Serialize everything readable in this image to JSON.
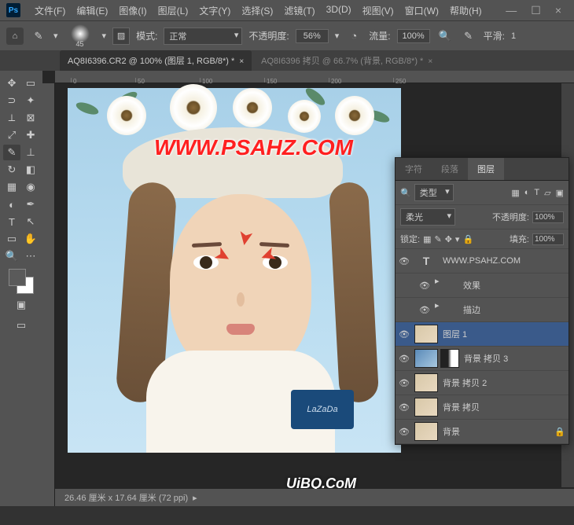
{
  "menu": {
    "items": [
      "文件(F)",
      "编辑(E)",
      "图像(I)",
      "图层(L)",
      "文字(Y)",
      "选择(S)",
      "滤镜(T)",
      "3D(D)",
      "视图(V)",
      "窗口(W)",
      "帮助(H)"
    ]
  },
  "wincontrols": {
    "min": "—",
    "max": "☐",
    "close": "×"
  },
  "optbar": {
    "brush_size": "45",
    "mode_label": "模式:",
    "mode_value": "正常",
    "opacity_label": "不透明度:",
    "opacity_value": "56%",
    "flow_label": "流量:",
    "flow_value": "100%",
    "smooth_label": "平滑:",
    "smooth_value": "1"
  },
  "tabs": [
    {
      "label": "AQ8I6396.CR2 @ 100% (图层 1, RGB/8*) *",
      "active": true
    },
    {
      "label": "AQ8I6396 拷贝 @ 66.7% (背景, RGB/8*) *",
      "active": false
    }
  ],
  "ruler_ticks": [
    "0",
    "50",
    "100",
    "150",
    "200",
    "250"
  ],
  "watermark": "WWW.PSAHZ.COM",
  "uibq": "UiBQ.CoM",
  "bluebox": "LaZaDa",
  "statusbar": "26.46 厘米 x 17.64 厘米 (72 ppi)",
  "panel": {
    "tabs": [
      "字符",
      "段落",
      "图层"
    ],
    "active_tab": 2,
    "filter_label": "类型",
    "blend_mode": "柔光",
    "opacity_label": "不透明度:",
    "opacity_value": "100%",
    "lock_label": "锁定:",
    "fill_label": "填充:",
    "fill_value": "100%",
    "layers": [
      {
        "vis": true,
        "type": "text",
        "name": "WWW.PSAHZ.COM"
      },
      {
        "vis": true,
        "type": "fx",
        "name": "效果",
        "child": true
      },
      {
        "vis": true,
        "type": "fx",
        "name": "描边",
        "child": true
      },
      {
        "vis": true,
        "type": "normal",
        "name": "图层 1",
        "selected": true
      },
      {
        "vis": true,
        "type": "masked",
        "name": "背景 拷贝 3"
      },
      {
        "vis": true,
        "type": "normal",
        "name": "背景 拷贝 2"
      },
      {
        "vis": true,
        "type": "normal",
        "name": "背景 拷贝"
      },
      {
        "vis": true,
        "type": "normal",
        "name": "背景",
        "locked": true
      }
    ]
  }
}
